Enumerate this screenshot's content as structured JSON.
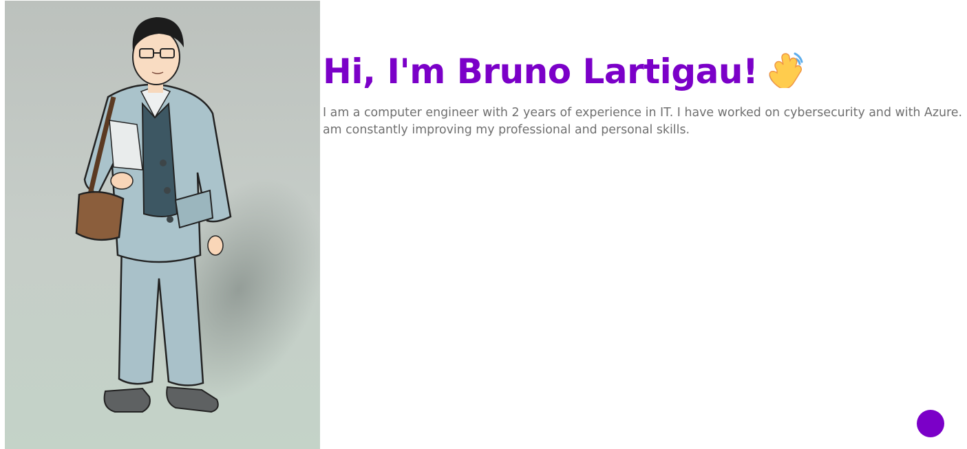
{
  "hero": {
    "title": "Hi, I'm Bruno Lartigau!",
    "title_emoji": "waving-hand",
    "intro": "I am a computer engineer with 2 years of experience in IT. I have worked on cybersecurity and with Azure. I am constantly improving my professional and personal skills.",
    "portrait": "cartoon-man-with-glasses-and-bag"
  },
  "floating_button": {
    "icon": "circle-button"
  },
  "colors": {
    "accent": "#7b00c8",
    "body_text": "#6f6f6f",
    "portrait_background": "#c1c9c3"
  }
}
